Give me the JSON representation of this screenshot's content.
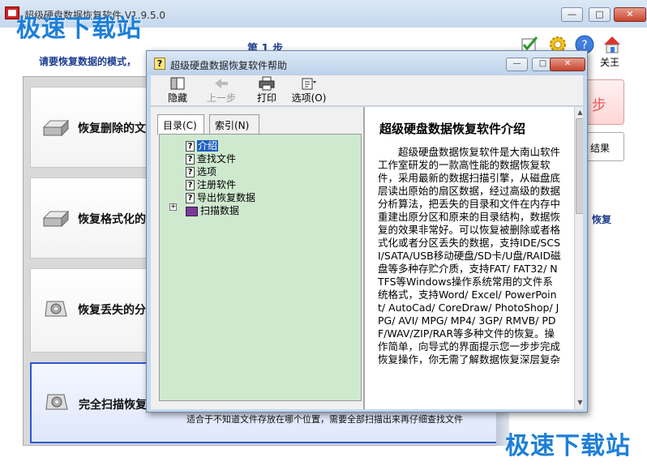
{
  "main_window": {
    "title": "超级硬盘数据恢复软件 V1.9.5.0",
    "minimize": "—",
    "maximize": "□",
    "close": "✕"
  },
  "watermark": {
    "top": "极速下载站",
    "bottom": "极速下载站"
  },
  "step": {
    "label": "第 1 步",
    "prompt": "请要恢复数据的模式，"
  },
  "top_icons": {
    "close_app": "关王"
  },
  "modes": [
    {
      "label": "恢复删除的文"
    },
    {
      "label": "恢复格式化的"
    },
    {
      "label": "恢复丢失的分"
    },
    {
      "label": "完全扫描恢复"
    }
  ],
  "mode_description": "适合于不知道文件存放在哪个位置，需要全部扫描出来再仔细查找文件",
  "side": {
    "next": "步",
    "result": "结果",
    "hint": "恢复"
  },
  "help_window": {
    "title": "超级硬盘数据恢复软件帮助",
    "minimize": "—",
    "maximize": "□",
    "close": "✕",
    "toolbar": [
      {
        "label": "隐藏",
        "icon": "hide-icon",
        "enabled": true
      },
      {
        "label": "上一步",
        "icon": "back-arrow-icon",
        "enabled": false
      },
      {
        "label": "打印",
        "icon": "printer-icon",
        "enabled": true
      },
      {
        "label": "选项(O)",
        "icon": "options-icon",
        "enabled": true
      }
    ],
    "tabs": [
      {
        "label": "目录(C)"
      },
      {
        "label": "索引(N)"
      }
    ],
    "tree": [
      {
        "label": "介绍",
        "selected": true
      },
      {
        "label": "查找文件"
      },
      {
        "label": "选项"
      },
      {
        "label": "注册软件"
      },
      {
        "label": "导出恢复数据"
      },
      {
        "label": "扫描数据"
      }
    ],
    "expand": "+",
    "content": {
      "title": "超级硬盘数据恢复软件介绍",
      "body": "超级硬盘数据恢复软件是大南山软件工作室研发的一款高性能的数据恢复软件，采用最新的数据扫描引擎，从磁盘底层读出原始的扇区数据，经过高级的数据分析算法，把丢失的目录和文件在内存中重建出原分区和原来的目录结构，数据恢复的效果非常好。可以恢复被删除或者格式化或者分区丢失的数据，支持IDE/SCSI/SATA/USB移动硬盘/SD卡/U盘/RAID磁盘等多种存贮介质，支持FAT/ FAT32/ NTFS等Windows操作系统常用的文件系统格式，支持Word/ Excel/ PowerPoint/ AutoCad/ CoreDraw/ PhotoShop/ JPG/ AVI/ MPG/ MP4/ 3GP/ RMVB/ PDF/WAV/ZIP/RAR等多种文件的恢复。操作简单，向导式的界面提示您一步步完成恢复操作，你无需了解数据恢复深层复杂"
    },
    "scroll_up": "▲",
    "scroll_down": "▼"
  },
  "colors": {
    "title_blue": "#1c3d8f",
    "watermark_blue": "#1d7fd6",
    "tree_bg": "#cfe9cf",
    "selection": "#1f5fbf"
  }
}
